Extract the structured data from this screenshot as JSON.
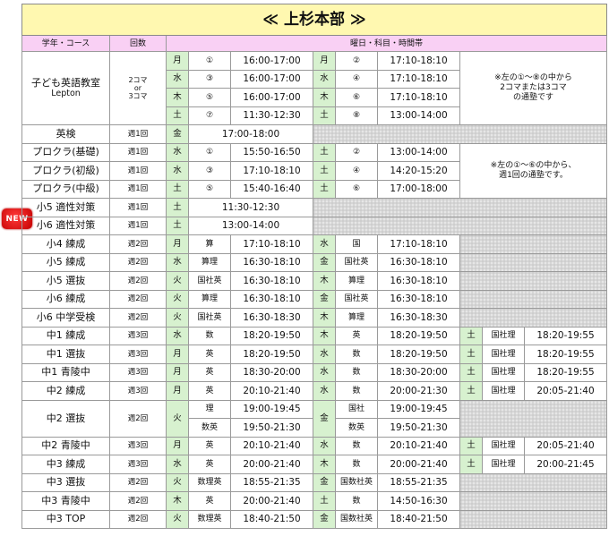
{
  "title": "≪ 上杉本部 ≫",
  "new_badge": "NEW",
  "header": {
    "course": "学年・コース",
    "count": "回数",
    "schedule": "曜日・科目・時間帯"
  },
  "lepton": {
    "name_line1": "子ども英語教室",
    "name_line2": "Lepton",
    "freq_line1": "2コマ",
    "freq_line2": "or",
    "freq_line3": "3コマ",
    "note": "※左の①～⑧の中から\n2コマまたは3コマ\nの通塾です",
    "slots": [
      [
        "月",
        "①",
        "16:00-17:00",
        "月",
        "②",
        "17:10-18:10"
      ],
      [
        "水",
        "③",
        "16:00-17:00",
        "水",
        "④",
        "17:10-18:10"
      ],
      [
        "木",
        "⑤",
        "16:00-17:00",
        "木",
        "⑥",
        "17:10-18:10"
      ],
      [
        "土",
        "⑦",
        "11:30-12:30",
        "土",
        "⑧",
        "13:00-14:00"
      ]
    ]
  },
  "eiken": {
    "name": "英検",
    "freq": "週1回",
    "day": "金",
    "time": "17:00-18:00"
  },
  "procra": {
    "note": "※左の①～⑥の中から、\n週1回の通塾です。",
    "rows": [
      {
        "name": "プロクラ(基礎)",
        "freq": "週1回",
        "c": [
          "水",
          "①",
          "15:50-16:50",
          "土",
          "②",
          "13:00-14:00"
        ]
      },
      {
        "name": "プロクラ(初級)",
        "freq": "週1回",
        "c": [
          "水",
          "③",
          "17:10-18:10",
          "土",
          "④",
          "14:20-15:20"
        ]
      },
      {
        "name": "プロクラ(中級)",
        "freq": "週1回",
        "c": [
          "土",
          "⑤",
          "15:40-16:40",
          "土",
          "⑥",
          "17:00-18:00"
        ]
      }
    ]
  },
  "tekisei": [
    {
      "name": "小5 適性対策",
      "freq": "週1回",
      "day": "土",
      "time": "11:30-12:30"
    },
    {
      "name": "小6 適性対策",
      "freq": "週1回",
      "day": "土",
      "time": "13:00-14:00"
    }
  ],
  "courses": [
    {
      "name": "小4 練成",
      "freq": "週2回",
      "c": [
        "月",
        "算",
        "17:10-18:10",
        "水",
        "国",
        "17:10-18:10"
      ]
    },
    {
      "name": "小5 練成",
      "freq": "週2回",
      "c": [
        "水",
        "算理",
        "16:30-18:10",
        "金",
        "国社英",
        "16:30-18:10"
      ]
    },
    {
      "name": "小5 選抜",
      "freq": "週2回",
      "c": [
        "火",
        "国社英",
        "16:30-18:10",
        "木",
        "算理",
        "16:30-18:10"
      ]
    },
    {
      "name": "小6 練成",
      "freq": "週2回",
      "c": [
        "火",
        "算理",
        "16:30-18:10",
        "金",
        "国社英",
        "16:30-18:10"
      ]
    },
    {
      "name": "小6 中学受検",
      "freq": "週2回",
      "c": [
        "火",
        "国社英",
        "16:30-18:30",
        "木",
        "算理",
        "16:30-18:30"
      ]
    },
    {
      "name": "中1 練成",
      "freq": "週3回",
      "c": [
        "水",
        "数",
        "18:20-19:50",
        "木",
        "英",
        "18:20-19:50",
        "土",
        "国社理",
        "18:20-19:55"
      ]
    },
    {
      "name": "中1 選抜",
      "freq": "週3回",
      "c": [
        "月",
        "英",
        "18:20-19:50",
        "水",
        "数",
        "18:20-19:50",
        "土",
        "国社理",
        "18:20-19:55"
      ]
    },
    {
      "name": "中1 青陵中",
      "freq": "週3回",
      "c": [
        "月",
        "英",
        "18:30-20:00",
        "水",
        "数",
        "18:30-20:00",
        "土",
        "国社理",
        "18:20-19:55"
      ]
    },
    {
      "name": "中2 練成",
      "freq": "週3回",
      "c": [
        "月",
        "英",
        "20:10-21:40",
        "水",
        "数",
        "20:00-21:30",
        "土",
        "国社理",
        "20:05-21:40"
      ]
    }
  ],
  "chu2_senbatsu": {
    "name": "中2 選抜",
    "freq": "週2回",
    "day1": "火",
    "subj1a": "理",
    "time1a": "19:00-19:45",
    "subj1b": "数英",
    "time1b": "19:50-21:30",
    "day2": "金",
    "subj2a": "国社",
    "time2a": "19:00-19:45",
    "subj2b": "数英",
    "time2b": "19:50-21:30"
  },
  "courses2": [
    {
      "name": "中2 青陵中",
      "freq": "週3回",
      "c": [
        "月",
        "英",
        "20:10-21:40",
        "水",
        "数",
        "20:10-21:40",
        "土",
        "国社理",
        "20:05-21:40"
      ]
    },
    {
      "name": "中3 練成",
      "freq": "週3回",
      "c": [
        "水",
        "英",
        "20:00-21:40",
        "木",
        "数",
        "20:00-21:40",
        "土",
        "国社理",
        "20:00-21:45"
      ]
    },
    {
      "name": "中3 選抜",
      "freq": "週2回",
      "c": [
        "火",
        "数理英",
        "18:55-21:35",
        "金",
        "国数社英",
        "18:55-21:35"
      ]
    },
    {
      "name": "中3 青陵中",
      "freq": "週2回",
      "c": [
        "木",
        "英",
        "20:00-21:40",
        "土",
        "数",
        "14:50-16:30"
      ]
    },
    {
      "name": "中3 TOP",
      "freq": "週2回",
      "c": [
        "火",
        "数理英",
        "18:40-21:50",
        "金",
        "国数社英",
        "18:40-21:50"
      ]
    }
  ],
  "colors": {
    "title_bg": "#fff8b0",
    "header_bg": "#f9d0f4",
    "day_bg": "#d7f1cf",
    "badge": "#e00000",
    "hatch": "#e6e6e6"
  }
}
